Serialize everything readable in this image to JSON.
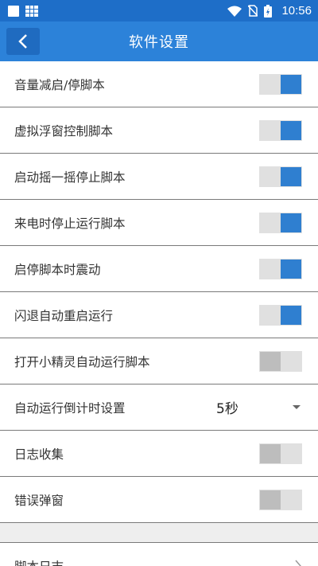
{
  "status_bar": {
    "time": "10:56"
  },
  "app_bar": {
    "title": "软件设置"
  },
  "settings": [
    {
      "name": "volume-start-stop",
      "label": "音量减启/停脚本",
      "enabled": true
    },
    {
      "name": "floating-window-control",
      "label": "虚拟浮窗控制脚本",
      "enabled": true
    },
    {
      "name": "shake-stop",
      "label": "启动摇一摇停止脚本",
      "enabled": true
    },
    {
      "name": "call-stop",
      "label": "来电时停止运行脚本",
      "enabled": true
    },
    {
      "name": "vibrate-on-toggle",
      "label": "启停脚本时震动",
      "enabled": true
    },
    {
      "name": "crash-restart",
      "label": "闪退自动重启运行",
      "enabled": true
    },
    {
      "name": "auto-run-on-open",
      "label": "打开小精灵自动运行脚本",
      "enabled": false
    }
  ],
  "countdown": {
    "label": "自动运行倒计时设置",
    "value": "5秒"
  },
  "settings2": [
    {
      "name": "log-collection",
      "label": "日志收集",
      "enabled": false
    },
    {
      "name": "error-popup",
      "label": "错误弹窗",
      "enabled": false
    }
  ],
  "script_log": {
    "label": "脚本日志"
  },
  "colors": {
    "status_bar": "#1e6ec8",
    "app_bar": "#2c82d9",
    "toggle_on": "#2f7fd0",
    "toggle_off": "#bdbdbd"
  }
}
